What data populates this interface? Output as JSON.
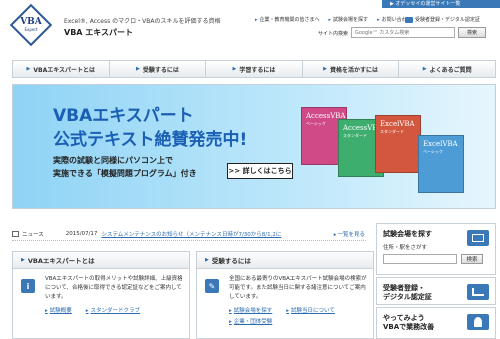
{
  "top_bar": {
    "odyssey_link": "▶ オデッセイの運営サイト一覧"
  },
  "header": {
    "logo_text": "VBA",
    "logo_sub": "Expert",
    "tagline": "Excel®, Access のマクロ・VBAのスキルを評価する資格",
    "site_title": "VBA エキスパート",
    "links": [
      "企業・教育機関の皆さまへ",
      "試験会場を探す",
      "お問い合わせ"
    ],
    "right_link": "受験者登録・デジタル認定証",
    "search_label": "サイト内検索",
    "search_placeholder": "Google™ カスタム検索",
    "search_button": "検索"
  },
  "nav": {
    "items": [
      "VBAエキスパートとは",
      "受験するには",
      "学習するには",
      "資格を活かすには",
      "よくあるご質問"
    ]
  },
  "banner": {
    "title_line1": "VBAエキスパート",
    "title_line2": "公式テキスト絶賛発売中!",
    "desc_line1": "実際の試験と同様にパソコン上で",
    "desc_line2": "実施できる「模擬問題プログラム」付き",
    "button": ">> 詳しくはこちら",
    "books": [
      {
        "title": "AccessVBA",
        "sub": "ベーシック"
      },
      {
        "title": "AccessVBA",
        "sub": "スタンダード"
      },
      {
        "title": "ExcelVBA",
        "sub": "スタンダード"
      },
      {
        "title": "ExcelVBA",
        "sub": "ベーシック"
      }
    ]
  },
  "news": {
    "label": "ニュース",
    "date": "2015/07/17",
    "text": "システムメンテナンスのお知らせ（メンテナンス日時が7/30から8/1,2に",
    "all_link": "一覧を見る"
  },
  "panels": [
    {
      "title": "VBAエキスパートとは",
      "icon": "i",
      "text": "VBAエキスパートの取得メリットや試験詳細、上級資格について、合格後に取得できる認定証などをご案内しています。",
      "links": [
        "試験概要",
        "スタンダードクラブ"
      ]
    },
    {
      "title": "受験するには",
      "icon": "✎",
      "text": "全国にある最寄りのVBAエキスパート試験会場の検索が可能です。また試験当日に関する諸注意についてご案内しています。",
      "links": [
        "試験会場を探す",
        "企業・団体受験",
        "試験当日について"
      ]
    }
  ],
  "sidebar": {
    "exam_search": {
      "title": "試験会場を探す",
      "sub": "住所・駅をさがす",
      "button": "検索"
    },
    "register": {
      "title_line1": "受験者登録・",
      "title_line2": "デジタル認定証"
    },
    "business": {
      "title_line1": "やってみよう",
      "title_line2": "VBAで業務改善"
    }
  },
  "colors": {
    "accent": "#2d6bb0",
    "banner_bg": "#a9def8",
    "banner_title": "#1a5fb4"
  }
}
